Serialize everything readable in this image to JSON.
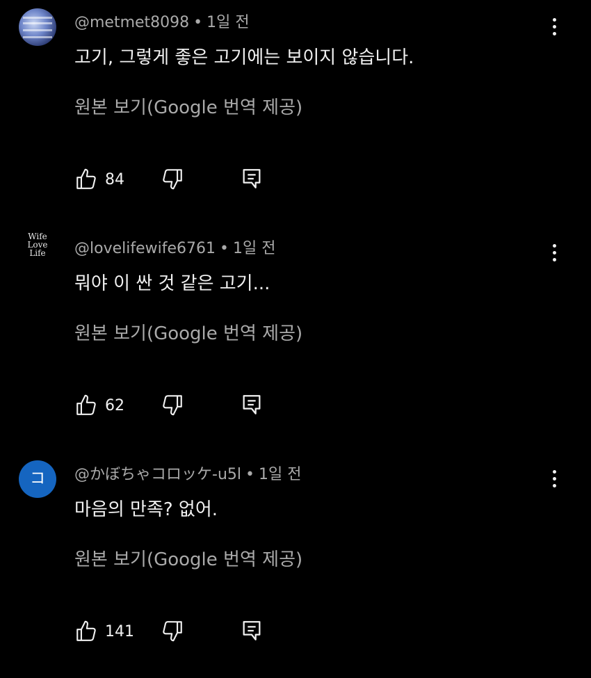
{
  "comments": [
    {
      "author": "@metmet8098",
      "time": "1일 전",
      "text": "고기, 그렇게 좋은 고기에는 보이지 않습니다.",
      "translate_label": "원본 보기(Google 번역 제공)",
      "likes": "84",
      "avatar": {
        "type": "photo"
      }
    },
    {
      "author": "@lovelifewife6761",
      "time": "1일 전",
      "text": "뭐야 이 싼 것 같은 고기...",
      "translate_label": "원본 보기(Google 번역 제공)",
      "likes": "62",
      "avatar": {
        "type": "text",
        "lines": [
          "Wife",
          "Love",
          "Life"
        ]
      }
    },
    {
      "author": "@かぼちゃコロッケ-u5l",
      "time": "1일 전",
      "text": "마음의 만족? 없어.",
      "translate_label": "원본 보기(Google 번역 제공)",
      "likes": "141",
      "avatar": {
        "type": "letter",
        "letter": "コ",
        "color": "#1565c0"
      }
    }
  ],
  "separator": "•",
  "icons": {
    "like": "thumbs-up-icon",
    "dislike": "thumbs-down-icon",
    "reply": "reply-icon",
    "more": "more-vert-icon"
  },
  "colors": {
    "background": "#000000",
    "primary_text": "#f1f1f1",
    "secondary_text": "#aaaaaa",
    "avatar_letter_bg": "#1565c0"
  }
}
